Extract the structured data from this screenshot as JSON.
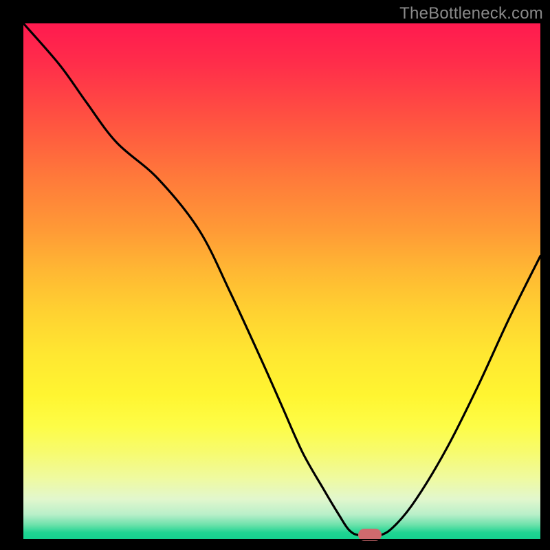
{
  "watermark": "TheBottleneck.com",
  "chart_data": {
    "type": "line",
    "title": "",
    "xlabel": "",
    "ylabel": "",
    "xlim": [
      0,
      100
    ],
    "ylim": [
      0,
      100
    ],
    "grid": false,
    "x": [
      0,
      7,
      12,
      18,
      26,
      34,
      40,
      46,
      50,
      54,
      58,
      61,
      63,
      65,
      69,
      72,
      76,
      82,
      88,
      94,
      100
    ],
    "values": [
      100,
      92,
      85,
      77,
      70,
      60,
      48,
      35,
      26,
      17,
      10,
      5,
      2,
      1,
      1,
      3,
      8,
      18,
      30,
      43,
      55
    ],
    "marker": {
      "x": 67,
      "y": 0
    },
    "background": "red-yellow-green vertical gradient"
  },
  "colors": {
    "pill": "#cf6a6e",
    "curve": "#000000",
    "frame": "#000000"
  }
}
